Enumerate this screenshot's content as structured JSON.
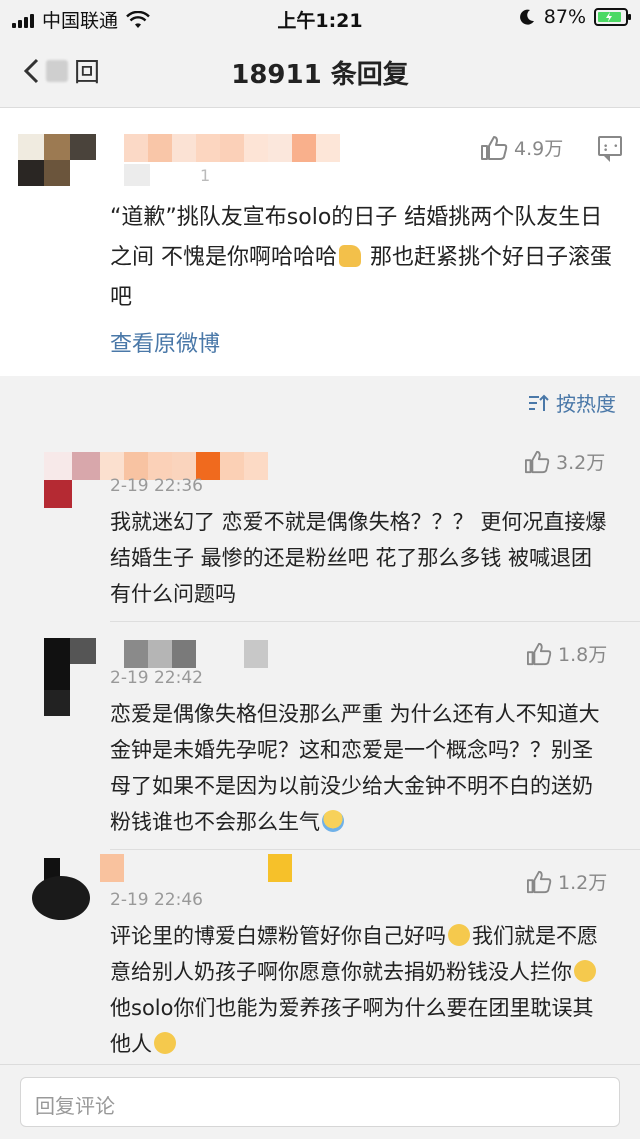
{
  "status_bar": {
    "carrier": "中国联通",
    "time": "上午1:21",
    "battery": "87%",
    "battery_level": 0.87
  },
  "nav": {
    "back_suffix": "回",
    "title": "18911 条回复"
  },
  "main_comment": {
    "time_fragment": "1",
    "likes": "4.9万",
    "text": "“道歉”挑队友宣布solo的日子  结婚挑两个队友生日之间 不愧是你啊哈哈哈",
    "text_after_emoji": " 那也赶紧挑个好日子滚蛋吧",
    "view_original": "查看原微博"
  },
  "sort": {
    "label": "按热度"
  },
  "replies": [
    {
      "time": "2-19 22:36",
      "likes": "3.2万",
      "text": "我就迷幻了 恋爱不就是偶像失格？？？ 更何况直接爆结婚生子 最惨的还是粉丝吧 花了那么多钱 被喊退团有什么问题吗"
    },
    {
      "time": "2-19 22:42",
      "likes": "1.8万",
      "text": "恋爱是偶像失格但没那么严重 为什么还有人不知道大金钟是未婚先孕呢？这和恋爱是一个概念吗？？别圣母了如果不是因为以前没少给大金钟不明不白的送奶粉钱谁也不会那么生气"
    },
    {
      "time": "2-19 22:46",
      "likes": "1.2万",
      "text_a": "评论里的博爱白嫖粉管好你自己好吗",
      "text_b": "我们就是不愿意给别人奶孩子啊你愿意你就去捐奶粉钱没人拦你",
      "text_c": "他solo你们也能为爱养孩子啊为什么要在团里耽误其他人"
    }
  ],
  "input": {
    "placeholder": "回复评论"
  },
  "icons": {
    "signal": "signal-bars-icon",
    "wifi": "wifi-icon",
    "moon": "moon-icon",
    "battery": "battery-icon",
    "back": "chevron-left-icon",
    "like": "thumbs-up-icon",
    "message": "message-icon",
    "sort": "sort-icon"
  }
}
